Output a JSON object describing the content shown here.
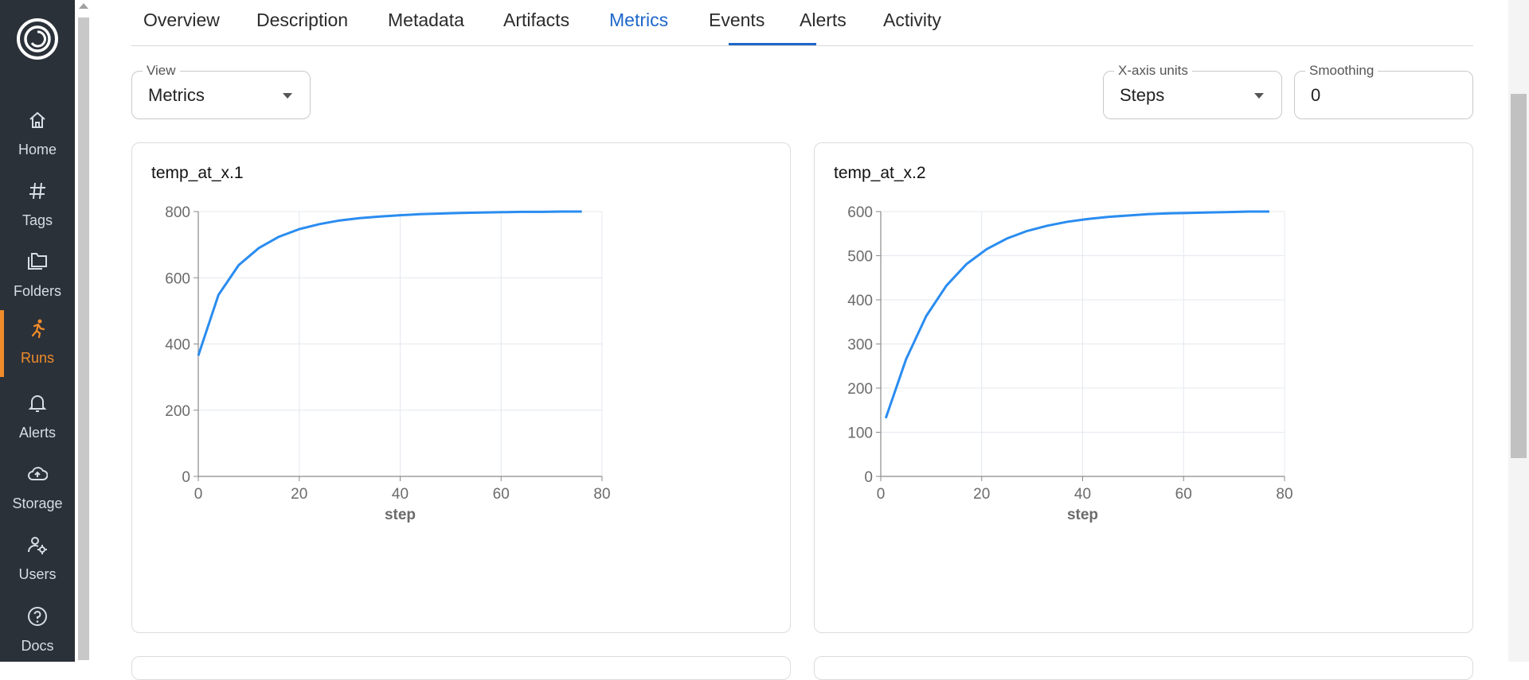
{
  "sidebar": {
    "items": [
      {
        "label": "Home",
        "icon": "home-icon"
      },
      {
        "label": "Tags",
        "icon": "hash-icon"
      },
      {
        "label": "Folders",
        "icon": "folders-icon"
      },
      {
        "label": "Runs",
        "icon": "run-icon",
        "active": true
      },
      {
        "label": "Alerts",
        "icon": "bell-icon"
      },
      {
        "label": "Storage",
        "icon": "cloud-upload-icon"
      },
      {
        "label": "Users",
        "icon": "users-gear-icon"
      },
      {
        "label": "Docs",
        "icon": "help-circle-icon"
      }
    ],
    "active_color": "#f08c2a"
  },
  "tabs": [
    "Overview",
    "Description",
    "Metadata",
    "Artifacts",
    "Metrics",
    "Events",
    "Alerts",
    "Activity"
  ],
  "active_tab": "Metrics",
  "controls": {
    "view": {
      "label": "View",
      "value": "Metrics"
    },
    "x_units": {
      "label": "X-axis units",
      "value": "Steps"
    },
    "smoothing": {
      "label": "Smoothing",
      "value": "0"
    }
  },
  "colors": {
    "accent": "#1e67c9",
    "line": "#2a8cf0"
  },
  "chart_data": [
    {
      "type": "line",
      "title": "temp_at_x.1",
      "xlabel": "step",
      "ylabel": "",
      "xlim": [
        0,
        80
      ],
      "ylim": [
        0,
        800
      ],
      "xticks": [
        0,
        20,
        40,
        60,
        80
      ],
      "yticks": [
        0,
        200,
        400,
        600,
        800
      ],
      "grid": true,
      "series": [
        {
          "x": [
            0,
            4,
            8,
            12,
            16,
            20,
            24,
            28,
            32,
            36,
            40,
            44,
            48,
            52,
            56,
            60,
            64,
            68,
            72,
            76
          ],
          "y": [
            365,
            548,
            638,
            690,
            724,
            747,
            762,
            773,
            780,
            785,
            789,
            792,
            794,
            796,
            797,
            798,
            799,
            799,
            800,
            800
          ]
        }
      ]
    },
    {
      "type": "line",
      "title": "temp_at_x.2",
      "xlabel": "step",
      "ylabel": "",
      "xlim": [
        0,
        80
      ],
      "ylim": [
        0,
        600
      ],
      "xticks": [
        0,
        20,
        40,
        60,
        80
      ],
      "yticks": [
        0,
        100,
        200,
        300,
        400,
        500,
        600
      ],
      "grid": true,
      "series": [
        {
          "x": [
            1,
            5,
            9,
            13,
            17,
            21,
            25,
            29,
            33,
            37,
            41,
            45,
            49,
            53,
            57,
            61,
            65,
            69,
            73,
            77
          ],
          "y": [
            132,
            265,
            363,
            432,
            481,
            515,
            539,
            556,
            568,
            577,
            583,
            588,
            591,
            594,
            596,
            597,
            598,
            599,
            600,
            600
          ]
        }
      ]
    }
  ]
}
